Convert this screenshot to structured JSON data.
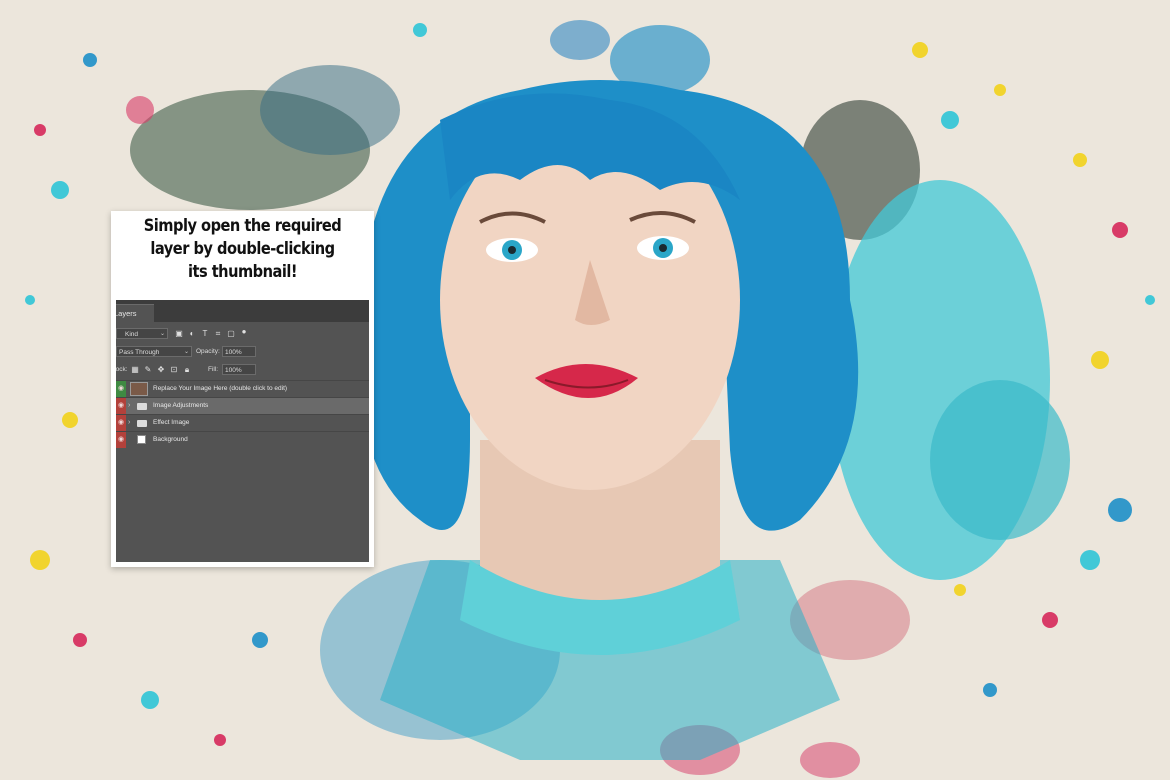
{
  "caption": {
    "line1": "Simply open the required",
    "line2": "layer by double-clicking",
    "line3": "its thumbnail!"
  },
  "layers_panel": {
    "tab_label": "Layers",
    "filter_kind": "Kind",
    "blend_mode": "Pass Through",
    "opacity_label": "Opacity:",
    "opacity_value": "100%",
    "lock_label": "Lock:",
    "fill_label": "Fill:",
    "fill_value": "100%",
    "icons": [
      "image-filter-icon",
      "adjustment-filter-icon",
      "type-filter-icon",
      "shape-filter-icon",
      "smart-object-filter-icon",
      "filter-toggle-icon",
      "lock-pixels-icon",
      "lock-paint-icon",
      "lock-position-icon",
      "lock-artboard-icon",
      "lock-all-icon"
    ],
    "layers": [
      {
        "name": "Replace Your Image Here (double click to edit)",
        "kind": "smart-object",
        "visible": true,
        "selected": false
      },
      {
        "name": "Image Adjustments",
        "kind": "group",
        "visible": true,
        "selected": true
      },
      {
        "name": "Effect Image",
        "kind": "group",
        "visible": true,
        "selected": false
      },
      {
        "name": "Background",
        "kind": "fill",
        "visible": true,
        "selected": false
      }
    ]
  },
  "colors": {
    "paper": "#ece6dc",
    "hair_blue": "#1e8fc8",
    "cyan": "#2ec4d6",
    "magenta_splash": "#d6285a",
    "yellow_splash": "#f2d21a",
    "panel_bg": "#535353",
    "visibility_red": "#b3413b"
  }
}
